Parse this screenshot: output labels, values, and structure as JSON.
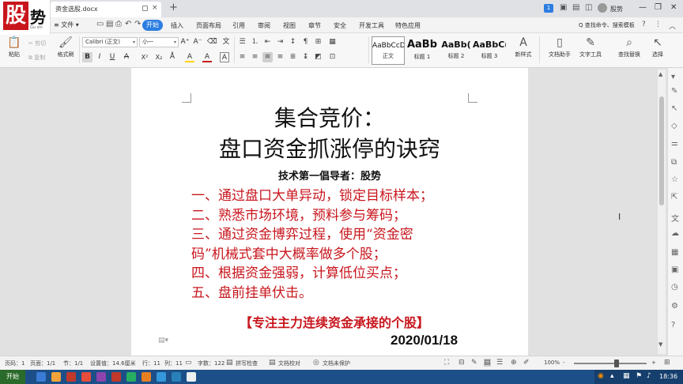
{
  "titlebar": {
    "doc_tab": "资金选股.docx",
    "close_tab": "×",
    "new_tab": "+",
    "notification_count": "1",
    "user_name": "股势",
    "minimize": "—",
    "maximize": "❐",
    "close": "✕"
  },
  "logo": {
    "seal_char": "股",
    "brush_char": "势",
    "caption": "Gu shi"
  },
  "ribbon_tabs": {
    "file": "≡ 文件 ▾",
    "start": "开始",
    "tabs": [
      "插入",
      "页面布局",
      "引用",
      "审阅",
      "视图",
      "章节",
      "安全",
      "开发工具",
      "特色应用"
    ],
    "search_cmd": "Q 查找命令、搜索模板",
    "help": "?"
  },
  "ribbon": {
    "paste": "粘贴",
    "cut": "剪切",
    "copy": "复制",
    "format_painter": "格式刷",
    "font_name": "Calibri (正文)",
    "font_size": "小一",
    "bold": "B",
    "italic": "I",
    "underline": "U",
    "strike": "A",
    "superscript": "X²",
    "subscript": "X₂",
    "font_color": "A",
    "highlight": "A",
    "char_border": "A",
    "styles": [
      {
        "sample": "AaBbCcDd",
        "name": "正文"
      },
      {
        "sample": "AaBb",
        "name": "标题 1"
      },
      {
        "sample": "AaBb(",
        "name": "标题 2"
      },
      {
        "sample": "AaBbC(",
        "name": "标题 3"
      }
    ],
    "new_style": "新样式",
    "doc_helper": "文档助手",
    "text_tools": "文字工具",
    "find_replace": "查找替换",
    "select": "选择"
  },
  "document": {
    "title_line_1": "集合竞价：",
    "title_line_2": "盘口资金抓涨停的诀窍",
    "author": "技术第一倡导者：股势",
    "lines": [
      "一、通过盘口大单异动，锁定目标样本；",
      "二、熟悉市场环境，预料参与筹码；",
      "三、通过资金博弈过程，使用“资金密",
      "码”机械式套中大概率做多个股；",
      "四、根据资金强弱，计算低位买点；",
      "五、盘前挂单伏击。"
    ],
    "focus": "【专注主力连续资金承接的个股】",
    "date": "2020/01/18"
  },
  "statusbar": {
    "page_no": "页码：1",
    "pages": "页面：1/1",
    "section": "节：1/1",
    "setting": "设置值：14.6厘米",
    "row": "行：11",
    "col": "列：11",
    "word_count": "字数：122",
    "spell_check": "拼写检查",
    "proofread": "文档校对",
    "protect": "文档未保护",
    "zoom": "100%",
    "zoom_minus": "-",
    "zoom_plus": "+"
  },
  "taskbar": {
    "start": "开始",
    "clock": "18:36",
    "app_colors": [
      "#3a7bd5",
      "#f2a33a",
      "#c0392b",
      "#e74c3c",
      "#8e44ad",
      "#c0392b",
      "#27ae60",
      "#e67e22",
      "#3498db",
      "#2980b9",
      "#ecf0f1"
    ]
  },
  "colors": {
    "accent": "#2b7de0",
    "doc_red": "#c8161d"
  }
}
